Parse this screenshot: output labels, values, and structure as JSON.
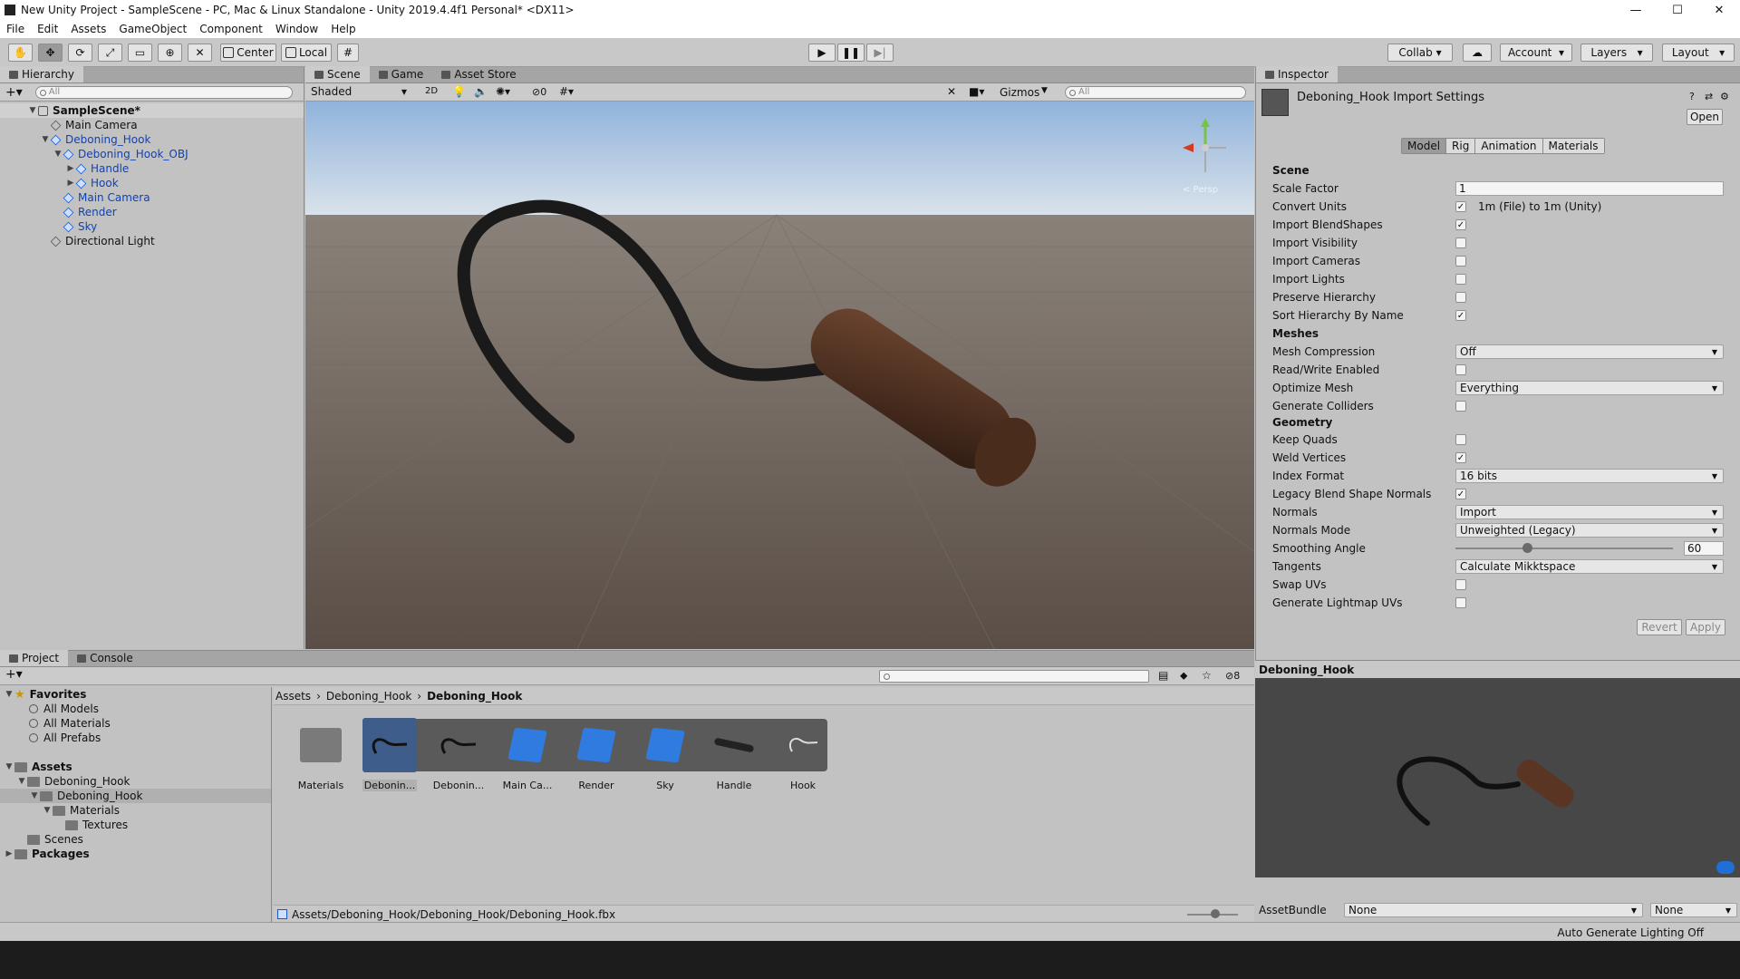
{
  "window": {
    "title": "New Unity Project - SampleScene - PC, Mac & Linux Standalone - Unity 2019.4.4f1 Personal* <DX11>",
    "min": "—",
    "max": "☐",
    "close": "✕"
  },
  "menu": [
    "File",
    "Edit",
    "Assets",
    "GameObject",
    "Component",
    "Window",
    "Help"
  ],
  "toolbar": {
    "pivot": "Center",
    "space": "Local",
    "collab": "Collab",
    "account": "Account",
    "layers": "Layers",
    "layout": "Layout"
  },
  "hierarchy": {
    "tab": "Hierarchy",
    "search_placeholder": "All",
    "scene": "SampleScene*",
    "items": [
      {
        "label": "Main Camera",
        "indent": 1,
        "arrow": "",
        "blue": false
      },
      {
        "label": "Deboning_Hook",
        "indent": 1,
        "arrow": "▼",
        "blue": true
      },
      {
        "label": "Deboning_Hook_OBJ",
        "indent": 2,
        "arrow": "▼",
        "blue": true
      },
      {
        "label": "Handle",
        "indent": 3,
        "arrow": "▶",
        "blue": true
      },
      {
        "label": "Hook",
        "indent": 3,
        "arrow": "▶",
        "blue": true
      },
      {
        "label": "Main Camera",
        "indent": 2,
        "arrow": "",
        "blue": true
      },
      {
        "label": "Render",
        "indent": 2,
        "arrow": "",
        "blue": true
      },
      {
        "label": "Sky",
        "indent": 2,
        "arrow": "",
        "blue": true
      },
      {
        "label": "Directional Light",
        "indent": 1,
        "arrow": "",
        "blue": false
      }
    ]
  },
  "scene_view": {
    "tabs": [
      "Scene",
      "Game",
      "Asset Store"
    ],
    "draw_mode": "Shaded",
    "mode_2d": "2D",
    "hidden_count": "0",
    "gizmos": "Gizmos",
    "search_placeholder": "All",
    "persp_label": "< Persp"
  },
  "inspector": {
    "tab": "Inspector",
    "title": "Deboning_Hook Import Settings",
    "open": "Open",
    "tabs": [
      "Model",
      "Rig",
      "Animation",
      "Materials"
    ],
    "sections": {
      "scene": "Scene",
      "meshes": "Meshes",
      "geometry": "Geometry"
    },
    "scale_factor_label": "Scale Factor",
    "scale_factor": "1",
    "convert_units_label": "Convert Units",
    "convert_units_note": "1m (File) to 1m (Unity)",
    "checks_scene": [
      {
        "label": "Import BlendShapes",
        "checked": "✓"
      },
      {
        "label": "Import Visibility",
        "checked": ""
      },
      {
        "label": "Import Cameras",
        "checked": ""
      },
      {
        "label": "Import Lights",
        "checked": ""
      },
      {
        "label": "Preserve Hierarchy",
        "checked": ""
      },
      {
        "label": "Sort Hierarchy By Name",
        "checked": "✓"
      }
    ],
    "mesh_compression_label": "Mesh Compression",
    "mesh_compression": "Off",
    "rw_label": "Read/Write Enabled",
    "optimize_label": "Optimize Mesh",
    "optimize": "Everything",
    "colliders_label": "Generate Colliders",
    "keep_quads_label": "Keep Quads",
    "weld_label": "Weld Vertices",
    "index_format_label": "Index Format",
    "index_format": "16 bits",
    "legacy_blend_label": "Legacy Blend Shape Normals",
    "normals_label": "Normals",
    "normals": "Import",
    "normals_mode_label": "Normals Mode",
    "normals_mode": "Unweighted (Legacy)",
    "smoothing_label": "Smoothing Angle",
    "smoothing_value": "60",
    "smoothing_fraction": 0.33,
    "tangents_label": "Tangents",
    "tangents": "Calculate Mikktspace",
    "swap_uvs_label": "Swap UVs",
    "lightmap_uvs_label": "Generate Lightmap UVs",
    "revert": "Revert",
    "apply": "Apply",
    "preview_title": "Deboning_Hook",
    "assetbundle_label": "AssetBundle",
    "assetbundle": "None",
    "assetbundle_variant": "None"
  },
  "project": {
    "tabs": [
      "Project",
      "Console"
    ],
    "hidden_count": "8",
    "favorites": {
      "label": "Favorites",
      "items": [
        "All Models",
        "All Materials",
        "All Prefabs"
      ]
    },
    "assets_tree": [
      {
        "label": "Assets",
        "indent": 0,
        "arrow": "▼",
        "bold": true
      },
      {
        "label": "Deboning_Hook",
        "indent": 1,
        "arrow": "▼",
        "bold": false
      },
      {
        "label": "Deboning_Hook",
        "indent": 2,
        "arrow": "▼",
        "bold": false,
        "selected": true
      },
      {
        "label": "Materials",
        "indent": 3,
        "arrow": "▼",
        "bold": false
      },
      {
        "label": "Textures",
        "indent": 4,
        "arrow": "",
        "bold": false
      },
      {
        "label": "Scenes",
        "indent": 1,
        "arrow": "",
        "bold": false
      },
      {
        "label": "Packages",
        "indent": 0,
        "arrow": "▶",
        "bold": true
      }
    ],
    "breadcrumb": [
      "Assets",
      "Deboning_Hook",
      "Deboning_Hook"
    ],
    "grid_items": [
      {
        "label": "Materials",
        "kind": "folder"
      },
      {
        "label": "Debonin...",
        "kind": "hook",
        "selected": true
      },
      {
        "label": "Debonin...",
        "kind": "hook"
      },
      {
        "label": "Main Ca...",
        "kind": "cube"
      },
      {
        "label": "Render",
        "kind": "cube"
      },
      {
        "label": "Sky",
        "kind": "cube"
      },
      {
        "label": "Handle",
        "kind": "handle"
      },
      {
        "label": "Hook",
        "kind": "hookwire"
      }
    ],
    "path": "Assets/Deboning_Hook/Deboning_Hook/Deboning_Hook.fbx"
  },
  "status": {
    "lighting": "Auto Generate Lighting Off"
  }
}
